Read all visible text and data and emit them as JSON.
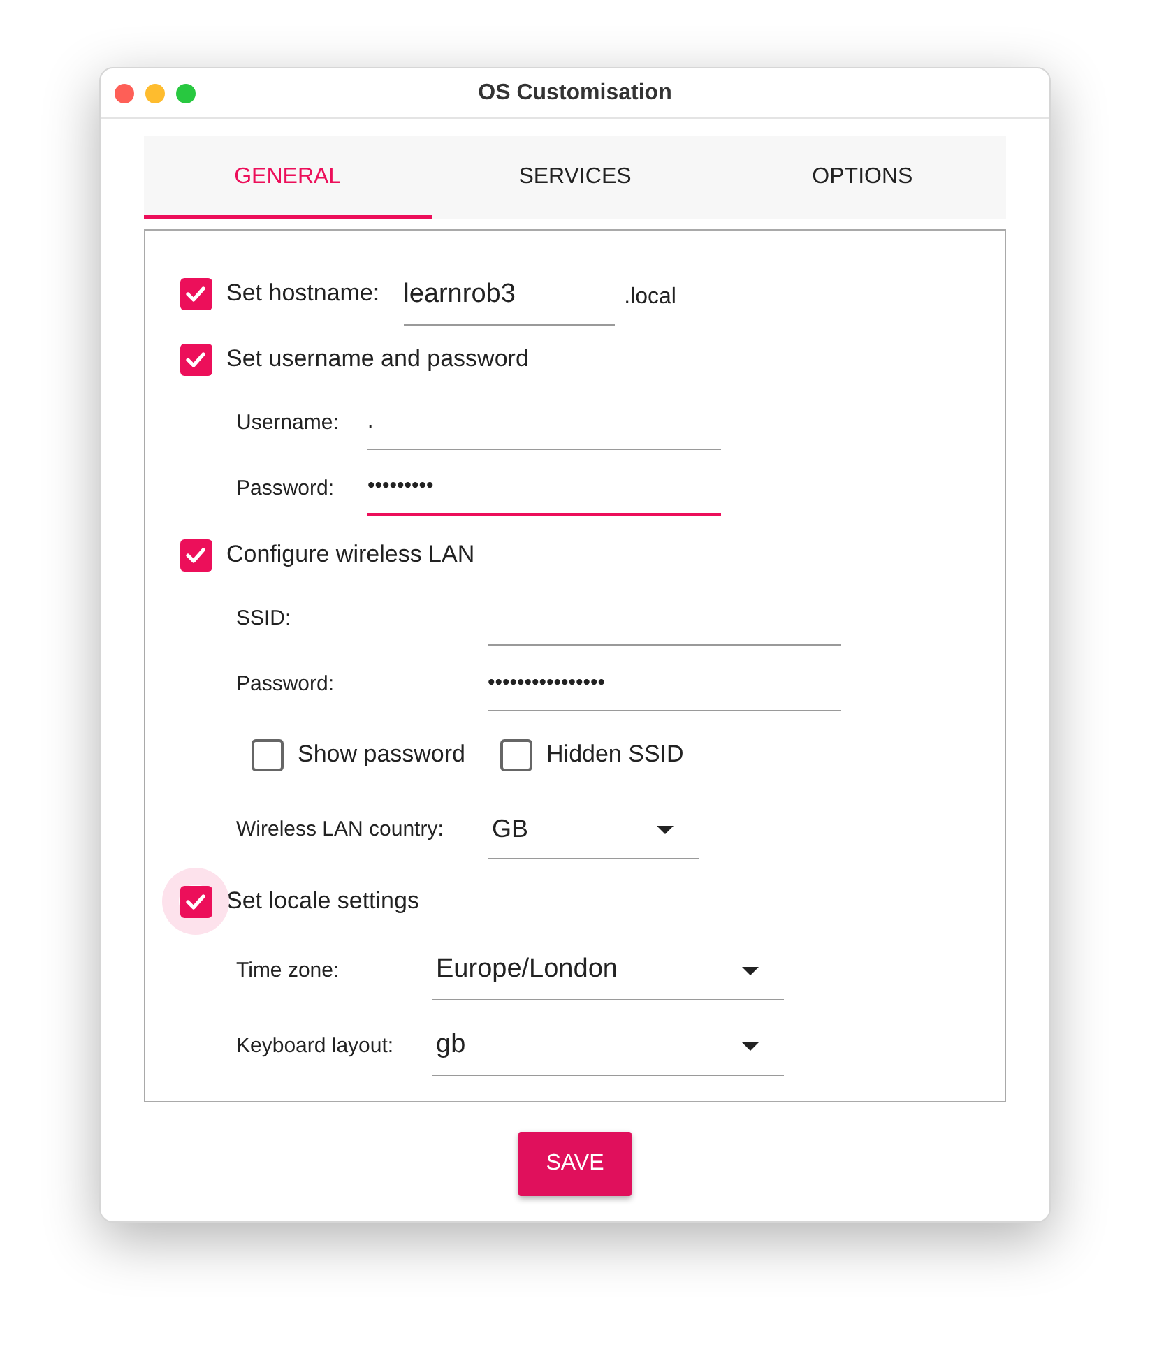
{
  "window": {
    "title": "OS Customisation"
  },
  "tabs": [
    {
      "label": "GENERAL",
      "selected": true
    },
    {
      "label": "SERVICES",
      "selected": false
    },
    {
      "label": "OPTIONS",
      "selected": false
    }
  ],
  "hostname": {
    "checked": true,
    "focused": false,
    "label": "Set hostname:",
    "value": "learnrob3",
    "suffix": ".local"
  },
  "user": {
    "checked": true,
    "focused": false,
    "label": "Set username and password",
    "fields": [
      {
        "label": "Username:",
        "value": ".",
        "focused": false
      },
      {
        "label": "Password:",
        "value": "•••••••••",
        "focused": true
      }
    ]
  },
  "wireless": {
    "checked": true,
    "focused": false,
    "label": "Configure wireless LAN",
    "fields": [
      {
        "label": "SSID:",
        "focused": false
      },
      {
        "label": "Password:",
        "value": "••••••••••••••••",
        "focused": false
      }
    ],
    "options": [
      {
        "label": "Show password",
        "checked": false
      },
      {
        "label": "Hidden SSID",
        "checked": false
      }
    ],
    "country": {
      "label": "Wireless LAN country:",
      "value": "GB"
    }
  },
  "locale": {
    "checked": true,
    "focused": true,
    "label": "Set locale settings",
    "selects": [
      {
        "label": "Time zone:",
        "value": "Europe/London"
      },
      {
        "label": "Keyboard layout:",
        "value": "gb"
      }
    ]
  },
  "save_button": "SAVE"
}
